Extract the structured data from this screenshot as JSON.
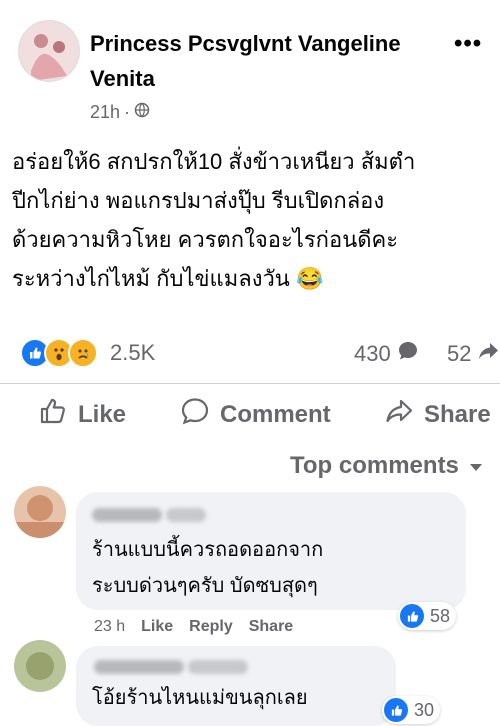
{
  "post": {
    "author": "Princess Pcsvglvnt Vangeline Venita",
    "time": "21h",
    "audience_icon": "globe-icon",
    "text_lines": [
      "อร่อยให้6 สกปรกให้10 สั่งข้าวเหนียว ส้มตำ",
      "ปีกไก่ย่าง พอแกรปมาส่งปุ๊บ รีบเปิดกล่อง",
      "ด้วยความหิวโหย ควรตกใจอะไรก่อนดีคะ",
      "ระหว่างไก่ไหม้ กับไข่แมลงวัน 😂"
    ]
  },
  "stats": {
    "reactions": "2.5K",
    "comments": "430",
    "shares": "52"
  },
  "actions": {
    "like": "Like",
    "comment": "Comment",
    "share": "Share"
  },
  "top_comments_label": "Top comments",
  "comments": [
    {
      "text_lines": [
        "ร้านแบบนี้ควรถอดออกจาก",
        "ระบบด่วนๆครับ บัดซบสุดๆ"
      ],
      "time": "23 h",
      "like": "Like",
      "reply": "Reply",
      "share": "Share",
      "reactions": "58"
    },
    {
      "text_lines": [
        "โอ้ยร้านไหนแม่ขนลุกเลย"
      ],
      "reactions": "30"
    }
  ],
  "colors": {
    "accent": "#1877f2",
    "secondary_text": "#65676b",
    "bubble": "#f0f2f5"
  }
}
